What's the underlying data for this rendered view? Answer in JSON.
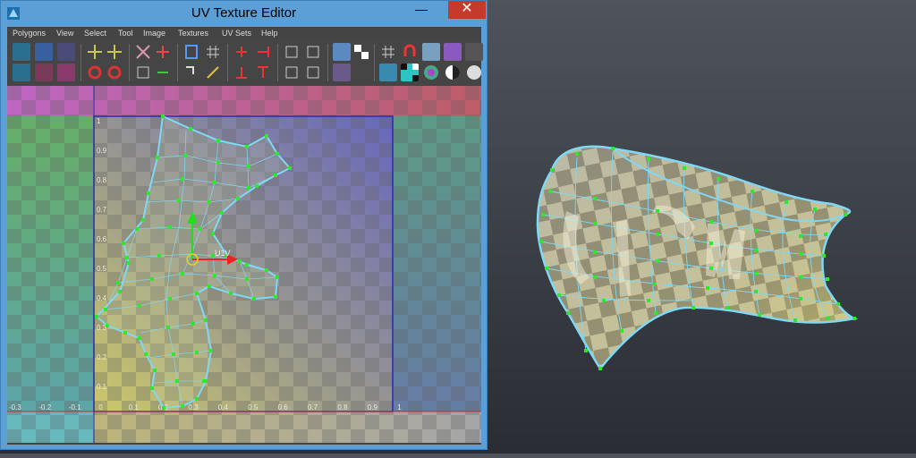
{
  "window": {
    "title": "UV Texture Editor",
    "minimize_glyph": "—",
    "maximize_glyph": "☐",
    "close_glyph": "✕"
  },
  "menu": [
    "Polygons",
    "View",
    "Select",
    "Tool",
    "Image",
    "Textures",
    "UV Sets",
    "Help"
  ],
  "uv_viewport": {
    "manipulator_label": "U1V",
    "v_axis_labels": [
      "1",
      "0.9",
      "0.8",
      "0.7",
      "0.6",
      "0.5",
      "0.4",
      "0.3",
      "0.2",
      "0.1"
    ],
    "u_axis_labels": [
      "-0.3",
      "-0.2",
      "-0.1",
      "0",
      "0.1",
      "0.2",
      "0.3",
      "0.4",
      "0.5",
      "0.6",
      "0.7",
      "0.8",
      "0.9",
      "1"
    ]
  },
  "colors": {
    "title_bar": "#5c9fd6",
    "close_button": "#c7392d",
    "uv_shell_edge": "#7fd8f5",
    "uv_vertex": "#2ee82e",
    "manipulator_v": "#22dd22",
    "manipulator_u": "#ee2222"
  },
  "icons": {
    "app": "uv-editor-icon",
    "scene": "textured-surface-mesh"
  }
}
